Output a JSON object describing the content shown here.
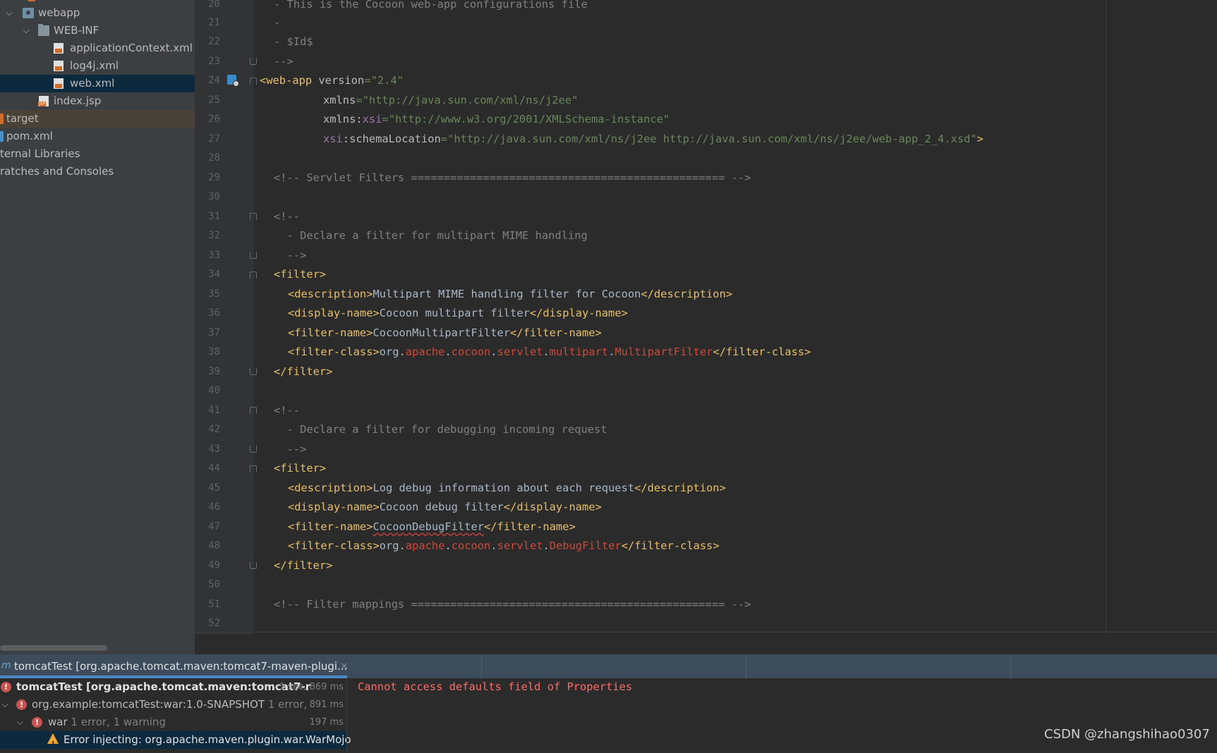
{
  "project_tree": {
    "items": [
      {
        "label": "webapp"
      },
      {
        "label": "WEB-INF"
      },
      {
        "label": "applicationContext.xml"
      },
      {
        "label": "log4j.xml"
      },
      {
        "label": "web.xml"
      },
      {
        "label": "index.jsp"
      },
      {
        "label": "target"
      },
      {
        "label": "pom.xml"
      },
      {
        "label": "ternal Libraries"
      },
      {
        "label": "ratches and Consoles"
      }
    ]
  },
  "editor": {
    "line_numbers": [
      "20",
      "21",
      "22",
      "23",
      "24",
      "25",
      "26",
      "27",
      "28",
      "29",
      "30",
      "31",
      "32",
      "33",
      "34",
      "35",
      "36",
      "37",
      "38",
      "39",
      "40",
      "41",
      "42",
      "43",
      "44",
      "45",
      "46",
      "47",
      "48",
      "49",
      "50",
      "51",
      "52"
    ],
    "tokens": {
      "l20": "- This is the Cocoon web-app configurations file",
      "l21": "-",
      "l22": "- $Id$",
      "l23": "-->",
      "l24_tag": "<web-app",
      "l24_attr": " version",
      "l24_eq": "=",
      "l24_val": "\"2.4\"",
      "l25_attr": "xmlns",
      "l25_eq": "=",
      "l25_val": "\"http://java.sun.com/xml/ns/j2ee\"",
      "l26_attr": "xmlns:",
      "l26_ns": "xsi",
      "l26_eq": "=",
      "l26_val": "\"http://www.w3.org/2001/XMLSchema-instance\"",
      "l27_ns": "xsi",
      "l27_attr": ":schemaLocation",
      "l27_eq": "=",
      "l27_val": "\"http://java.sun.com/xml/ns/j2ee http://java.sun.com/xml/ns/j2ee/web-app_2_4.xsd\"",
      "l27_close": ">",
      "l29": "<!-- Servlet Filters ================================================ -->",
      "l31": "<!--",
      "l32": "  - Declare a filter for multipart MIME handling",
      "l33": "  -->",
      "l34": "<filter>",
      "l35_open": "<description>",
      "l35_text": "Multipart MIME handling filter for Cocoon",
      "l35_close": "</description>",
      "l36_open": "<display-name>",
      "l36_text": "Cocoon multipart filter",
      "l36_close": "</display-name>",
      "l37_open": "<filter-name>",
      "l37_text": "CocoonMultipartFilter",
      "l37_close": "</filter-name>",
      "l38_open": "<filter-class>",
      "l38_org": "org",
      "l38_dot": ".",
      "l38_p1": "apache",
      "l38_p2": "cocoon",
      "l38_p3": "servlet",
      "l38_p4": "multipart",
      "l38_cls": "MultipartFilter",
      "l38_close": "</filter-class>",
      "l39": "</filter>",
      "l41": "<!--",
      "l42": "  - Declare a filter for debugging incoming request",
      "l43": "  -->",
      "l44": "<filter>",
      "l45_open": "<description>",
      "l45_text": "Log debug information about each request",
      "l45_close": "</description>",
      "l46_open": "<display-name>",
      "l46_text": "Cocoon debug filter",
      "l46_close": "</display-name>",
      "l47_open": "<filter-name>",
      "l47_text": "CocoonDebugFilter",
      "l47_close": "</filter-name>",
      "l48_open": "<filter-class>",
      "l48_org": "org",
      "l48_dot": ".",
      "l48_p1": "apache",
      "l48_p2": "cocoon",
      "l48_p3": "servlet",
      "l48_cls": "DebugFilter",
      "l48_close": "</filter-class>",
      "l49": "</filter>",
      "l51": "<!-- Filter mappings ================================================ -->"
    }
  },
  "run_panel": {
    "tab_label": "tomcatTest [org.apache.tomcat.maven:tomcat7-maven-plugi...",
    "close_glyph": "×",
    "tree": [
      {
        "label": "tomcatTest [org.apache.tomcat.maven:tomcat7-r",
        "time": "1 sec, 869 ms"
      },
      {
        "label": "org.example:tomcatTest:war:1.0-SNAPSHOT",
        "sub": "1 error,",
        "time": "891 ms"
      },
      {
        "label": "war",
        "sub": "1 error, 1 warning",
        "time": "197 ms"
      },
      {
        "label": "Error injecting: org.apache.maven.plugin.war.WarMojo"
      }
    ],
    "console_message": "Cannot access defaults field of Properties"
  },
  "watermark": "CSDN @zhangshihao0307",
  "colors": {
    "editor_bg": "#2b2b2b",
    "sidebar_bg": "#3c3f41",
    "tag": "#e8bf6a",
    "string": "#6a8759",
    "comment": "#808080",
    "error": "#ff6b68",
    "selection": "#0d293e"
  },
  "icons": [
    "chevron-down-icon",
    "web-folder-icon",
    "folder-icon",
    "xml-file-icon",
    "jsp-file-icon",
    "bookmark-icon",
    "maven-icon",
    "close-icon",
    "error-icon",
    "warning-icon"
  ]
}
